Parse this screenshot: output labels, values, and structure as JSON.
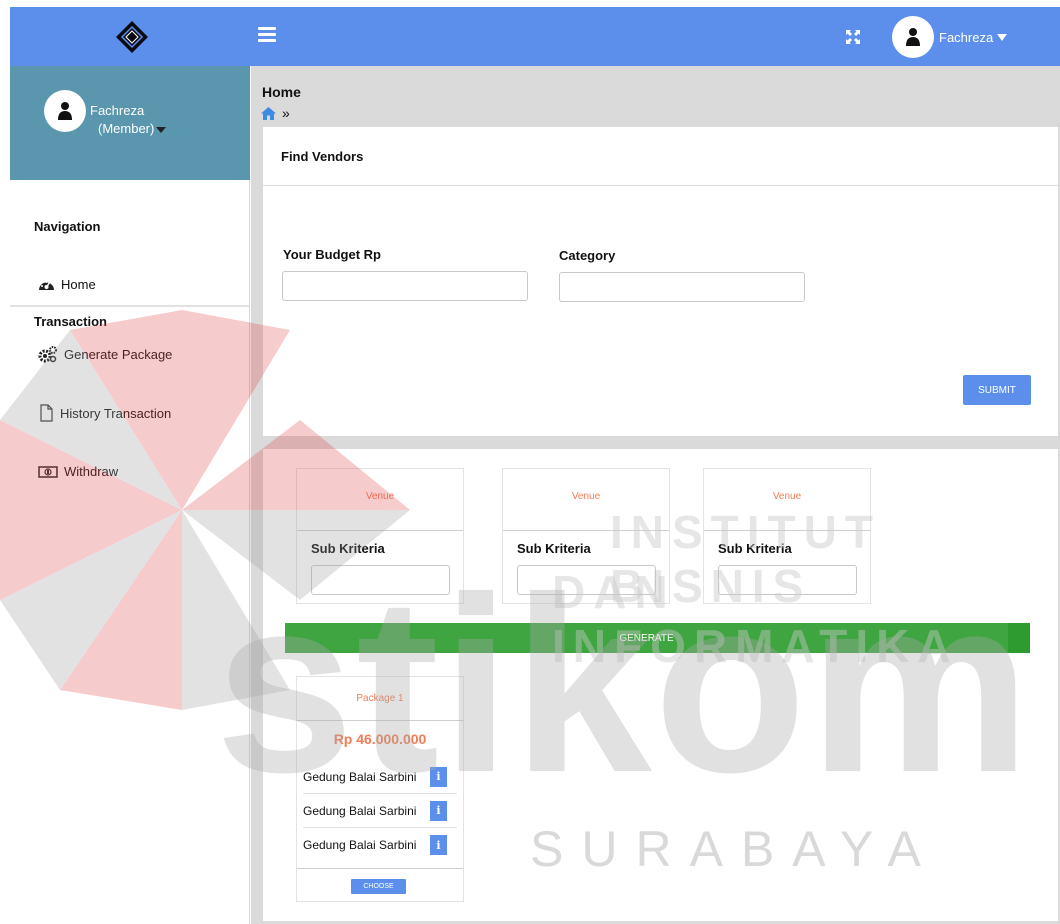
{
  "header": {
    "username": "Fachreza"
  },
  "sidebar": {
    "profile_name": "Fachreza",
    "profile_role": "(Member)",
    "nav_heading": "Navigation",
    "home_label": "Home",
    "transaction_heading": "Transaction",
    "items": [
      {
        "label": "Generate Package"
      },
      {
        "label": "History Transaction"
      },
      {
        "label": "Withdraw"
      }
    ]
  },
  "main": {
    "page_title": "Home",
    "breadcrumb_sep": "»",
    "find_title": "Find Vendors",
    "budget_label": "Your Budget Rp",
    "budget_value": "",
    "category_label": "Category",
    "category_value": "",
    "submit_label": "SUBMIT",
    "criteria": [
      {
        "head": "Venue",
        "sub": "Sub Kriteria"
      },
      {
        "head": "Venue",
        "sub": "Sub Kriteria"
      },
      {
        "head": "Venue",
        "sub": "Sub Kriteria"
      }
    ],
    "generate_label": "GENERATE",
    "package": {
      "title": "Package 1",
      "price": "Rp 46.000.000",
      "items": [
        "Gedung Balai Sarbini",
        "Gedung Balai Sarbini",
        "Gedung Balai Sarbini"
      ],
      "info_glyph": "i",
      "choose_label": "CHOOSE"
    }
  },
  "watermark": {
    "line1": "INSTITUT BISNIS",
    "line2": "DAN INFORMATIKA",
    "brand": "stikom",
    "city": "SURABAYA"
  },
  "colors": {
    "topbar": "#5c8fec",
    "profile_bg": "#5a96ad",
    "accent_orange": "#f07d56",
    "generate_green": "#3fa541"
  },
  "icons": [
    "logo-icon",
    "hamburger-icon",
    "fullscreen-icon",
    "user-icon",
    "dashboard-icon",
    "cogs-icon",
    "file-icon",
    "money-icon",
    "home-icon",
    "info-icon"
  ]
}
